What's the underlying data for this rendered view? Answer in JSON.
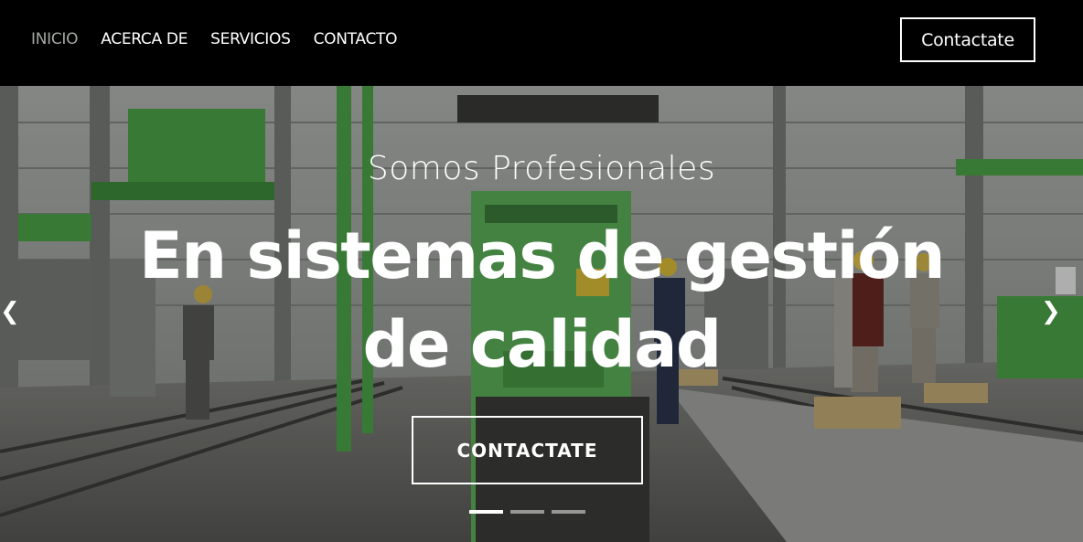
{
  "nav": {
    "links": [
      {
        "label": "INICIO",
        "active": true
      },
      {
        "label": "ACERCA DE",
        "active": false
      },
      {
        "label": "SERVICIOS",
        "active": false
      },
      {
        "label": "CONTACTO",
        "active": false
      }
    ],
    "cta_label": "Contactate"
  },
  "hero": {
    "subtitle": "Somos Profesionales",
    "title": "En sistemas de gestión de calidad",
    "button_label": "CONTACTATE",
    "slide_count": 3,
    "active_slide": 1,
    "prev_icon": "chevron-left-icon",
    "next_icon": "chevron-right-icon"
  },
  "colors": {
    "nav_bg": "#000000",
    "active_link": "#a3a8a3",
    "machine_green": "#5fb55a",
    "text": "#ffffff"
  }
}
